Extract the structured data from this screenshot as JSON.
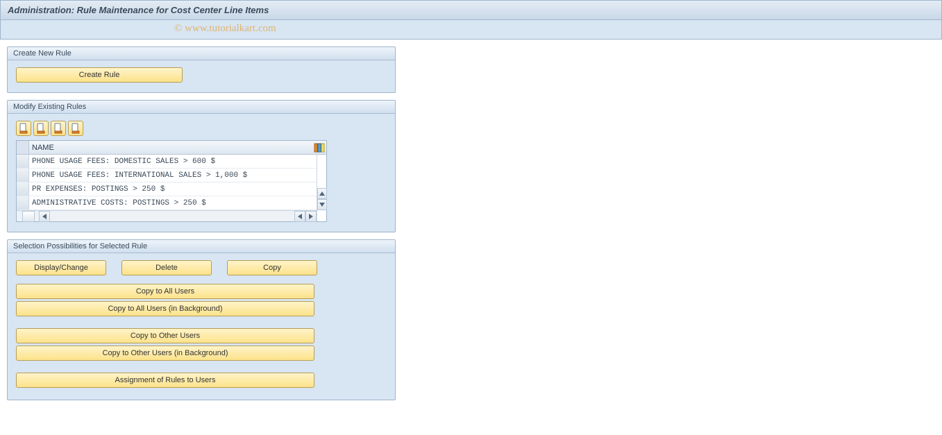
{
  "window_title": "Administration: Rule Maintenance for Cost Center Line Items",
  "watermark": "© www.tutorialkart.com",
  "group_create": {
    "title": "Create New Rule",
    "create_btn": "Create Rule"
  },
  "group_modify": {
    "title": "Modify Existing Rules",
    "column_header": "NAME",
    "rows": [
      "PHONE USAGE FEES: DOMESTIC SALES > 600 $",
      "PHONE USAGE FEES: INTERNATIONAL SALES > 1,000 $",
      "PR EXPENSES: POSTINGS > 250 $",
      "ADMINISTRATIVE COSTS: POSTINGS > 250 $"
    ]
  },
  "group_select": {
    "title": "Selection Possibilities for Selected Rule",
    "display_change": "Display/Change",
    "delete": "Delete",
    "copy": "Copy",
    "copy_all": "Copy to All Users",
    "copy_all_bg": "Copy to All Users (in Background)",
    "copy_other": "Copy to Other Users",
    "copy_other_bg": "Copy to Other Users (in Background)",
    "assignment": "Assignment of Rules to Users"
  },
  "colors": {
    "panel_bg": "#d8e5f2",
    "panel_border": "#9fb5cc",
    "button_bg_top": "#fff4c9",
    "button_bg_bottom": "#fce28a",
    "button_border": "#b79d55"
  },
  "icons": {
    "toolbar_icon": "document-variant-icon",
    "column_settings": "column-settings-icon"
  }
}
